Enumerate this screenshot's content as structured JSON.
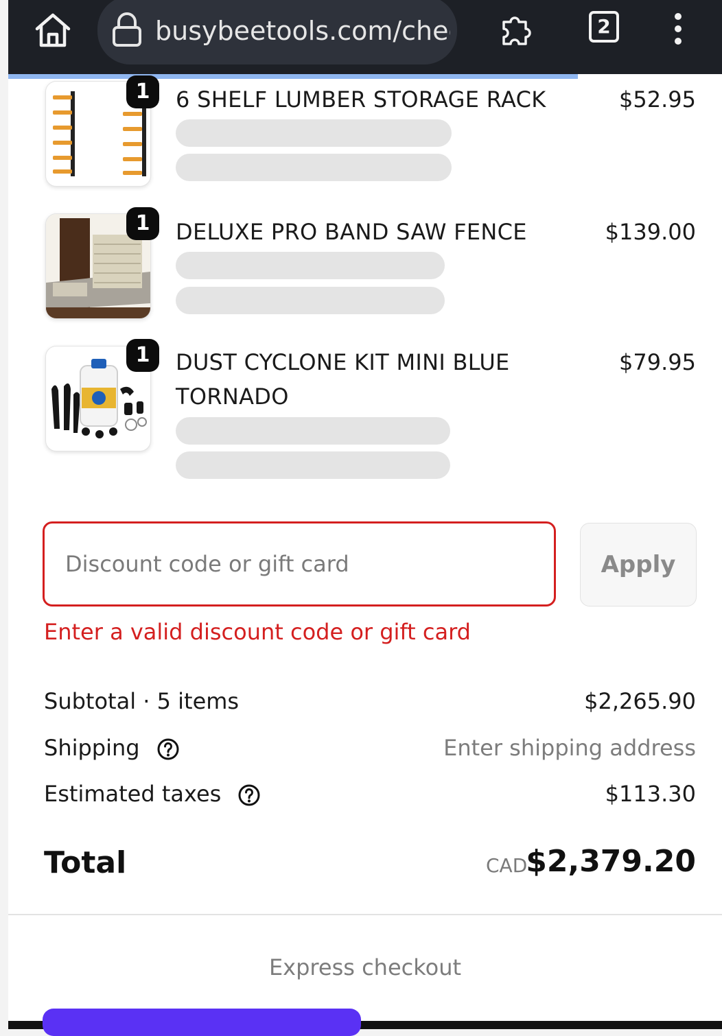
{
  "browser": {
    "url": "busybeetools.com/chec",
    "tab_count": "2"
  },
  "cart": {
    "items": [
      {
        "name": "6 SHELF LUMBER STORAGE RACK",
        "price": "$52.95",
        "quantity": "1"
      },
      {
        "name": "DELUXE PRO BAND SAW FENCE",
        "price": "$139.00",
        "quantity": "1"
      },
      {
        "name_line1": "DUST CYCLONE KIT MINI BLUE",
        "name_line2": "TORNADO",
        "price": "$79.95",
        "quantity": "1"
      }
    ]
  },
  "discount": {
    "placeholder": "Discount code or gift card",
    "value": "",
    "apply_label": "Apply",
    "error": "Enter a valid discount code or gift card"
  },
  "summary": {
    "subtotal_label": "Subtotal · 5 items",
    "subtotal_value": "$2,265.90",
    "shipping_label": "Shipping",
    "shipping_value": "Enter shipping address",
    "taxes_label": "Estimated taxes",
    "taxes_value": "$113.30",
    "total_label": "Total",
    "currency": "CAD",
    "total_value": "$2,379.20"
  },
  "express": {
    "label": "Express checkout"
  },
  "colors": {
    "error": "#d41f1f",
    "express_button": "#5a31f4",
    "browser_bar": "#1d2026"
  }
}
